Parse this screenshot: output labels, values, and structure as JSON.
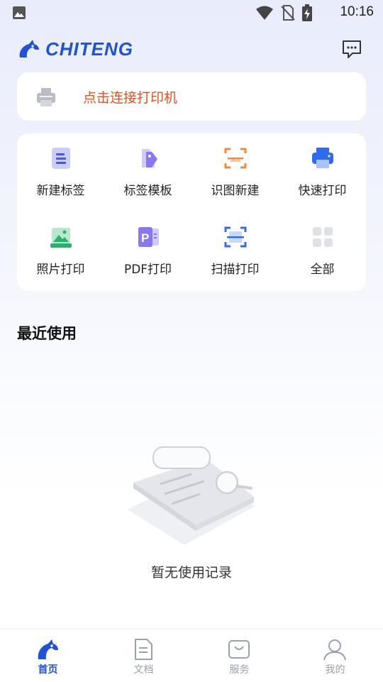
{
  "status_bar": {
    "time": "10:16"
  },
  "header": {
    "brand": "CHITENG"
  },
  "printer_connect": {
    "label": "点击连接打印机"
  },
  "features": [
    {
      "label": "新建标签",
      "icon": "new-label-icon"
    },
    {
      "label": "标签模板",
      "icon": "label-template-icon"
    },
    {
      "label": "识图新建",
      "icon": "scan-create-icon"
    },
    {
      "label": "快速打印",
      "icon": "quick-print-icon"
    },
    {
      "label": "照片打印",
      "icon": "photo-print-icon"
    },
    {
      "label": "PDF打印",
      "icon": "pdf-print-icon"
    },
    {
      "label": "扫描打印",
      "icon": "scan-print-icon"
    },
    {
      "label": "全部",
      "icon": "all-apps-icon"
    }
  ],
  "recent": {
    "title": "最近使用",
    "empty_text": "暂无使用记录"
  },
  "tabbar": {
    "items": [
      {
        "label": "首页",
        "icon": "home-icon",
        "active": true
      },
      {
        "label": "文档",
        "icon": "document-icon",
        "active": false
      },
      {
        "label": "服务",
        "icon": "service-bag-icon",
        "active": false
      },
      {
        "label": "我的",
        "icon": "profile-icon",
        "active": false
      }
    ]
  },
  "colors": {
    "brand": "#1f52d8",
    "accent_orange": "#e8501c",
    "icon_purple": "#7b6df0",
    "tab_inactive": "#9aa0aa"
  }
}
